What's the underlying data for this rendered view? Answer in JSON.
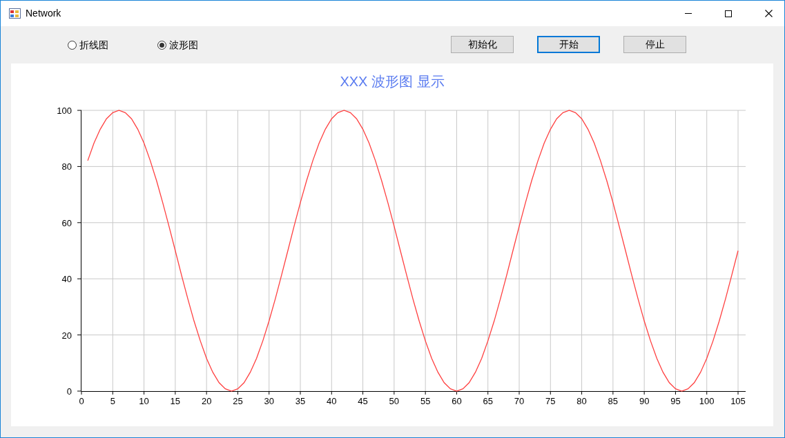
{
  "window": {
    "title": "Network"
  },
  "radios": [
    {
      "label": "折线图",
      "selected": false
    },
    {
      "label": "波形图",
      "selected": true
    }
  ],
  "buttons": [
    {
      "label": "初始化",
      "focused": false
    },
    {
      "label": "开始",
      "focused": true
    },
    {
      "label": "停止",
      "focused": false
    }
  ],
  "chart_data": {
    "type": "line",
    "title": "XXX 波形图 显示",
    "x": [
      1,
      2,
      3,
      4,
      5,
      6,
      7,
      8,
      9,
      10,
      11,
      12,
      13,
      14,
      15,
      16,
      17,
      18,
      19,
      20,
      21,
      22,
      23,
      24,
      25,
      26,
      27,
      28,
      29,
      30,
      31,
      32,
      33,
      34,
      35,
      36,
      37,
      38,
      39,
      40,
      41,
      42,
      43,
      44,
      45,
      46,
      47,
      48,
      49,
      50,
      51,
      52,
      53,
      54,
      55,
      56,
      57,
      58,
      59,
      60,
      61,
      62,
      63,
      64,
      65,
      66,
      67,
      68,
      69,
      70,
      71,
      72,
      73,
      74,
      75,
      76,
      77,
      78,
      79,
      80,
      81,
      82,
      83,
      84,
      85,
      86,
      87,
      88,
      89,
      90,
      91,
      92,
      93,
      94,
      95,
      96,
      97,
      98,
      99,
      100,
      101,
      102,
      103,
      104,
      105
    ],
    "series": [
      {
        "color": "#ff4040",
        "values": [
          82.1,
          88.3,
          93.3,
          97,
          99.2,
          100,
          99.2,
          97,
          93.3,
          88.3,
          82.1,
          75,
          67.1,
          58.7,
          50,
          41.3,
          32.9,
          25,
          17.9,
          11.7,
          6.7,
          3,
          0.8,
          0,
          0.8,
          3,
          6.7,
          11.7,
          17.9,
          25,
          32.9,
          41.3,
          50,
          58.7,
          67.1,
          75,
          82.1,
          88.3,
          93.3,
          97,
          99.2,
          100,
          99.2,
          97,
          93.3,
          88.3,
          82.1,
          75,
          67.1,
          58.7,
          50,
          41.3,
          32.9,
          25,
          17.9,
          11.7,
          6.7,
          3,
          0.8,
          0,
          0.8,
          3,
          6.7,
          11.7,
          17.9,
          25,
          32.9,
          41.3,
          50,
          58.7,
          67.1,
          75,
          82.1,
          88.3,
          93.3,
          97,
          99.2,
          100,
          99.2,
          97,
          93.3,
          88.3,
          82.1,
          75,
          67.1,
          58.7,
          50,
          41.3,
          32.9,
          25,
          17.9,
          11.7,
          6.7,
          3,
          0.8,
          0,
          0.8,
          3,
          6.7,
          11.7,
          17.9,
          25,
          32.9,
          41.3,
          50
        ]
      }
    ],
    "xlim": [
      0,
      105
    ],
    "ylim": [
      0,
      100
    ],
    "xticks": [
      0,
      5,
      10,
      15,
      20,
      25,
      30,
      35,
      40,
      45,
      50,
      55,
      60,
      65,
      70,
      75,
      80,
      85,
      90,
      95,
      100,
      105
    ],
    "yticks": [
      0,
      20,
      40,
      60,
      80,
      100
    ],
    "grid": true
  }
}
